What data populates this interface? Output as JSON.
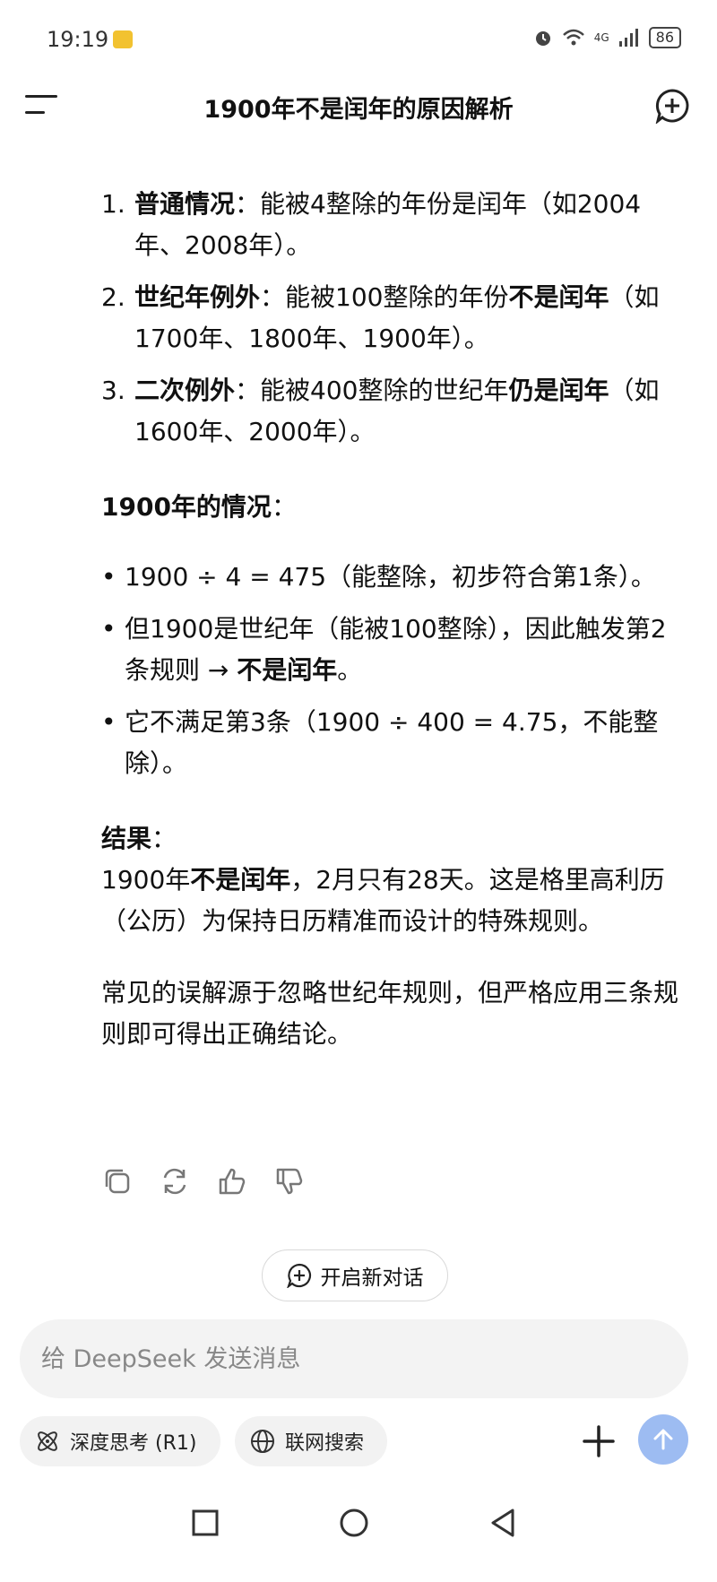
{
  "status": {
    "time": "19:19",
    "battery": "86",
    "network": "4G"
  },
  "header": {
    "title": "1900年不是闰年的原因解析"
  },
  "rules": [
    {
      "num": "1.",
      "bold": "普通情况",
      "text": "：能被4整除的年份是闰年（如2004年、2008年）。",
      "bold2": "",
      "text2": ""
    },
    {
      "num": "2.",
      "bold": "世纪年例外",
      "text": "：能被100整除的年份",
      "bold2": "不是闰年",
      "text2": "（如1700年、1800年、1900年）。"
    },
    {
      "num": "3.",
      "bold": "二次例外",
      "text": "：能被400整除的世纪年",
      "bold2": "仍是闰年",
      "text2": "（如1600年、2000年）。"
    }
  ],
  "case": {
    "heading_bold": "1900年的情况",
    "heading_tail": "：",
    "bullets": [
      {
        "text": "1900 ÷ 4 = 475（能整除，初步符合第1条）。",
        "bold": "",
        "tail": ""
      },
      {
        "text": "但1900是世纪年（能被100整除），因此触发第2条规则 → ",
        "bold": "不是闰年",
        "tail": "。"
      },
      {
        "text": "它不满足第3条（1900 ÷ 400 = 4.75，不能整除）。",
        "bold": "",
        "tail": ""
      }
    ]
  },
  "result": {
    "heading_bold": "结果",
    "heading_tail": "：",
    "pre": "1900年",
    "bold": "不是闰年",
    "post": "，2月只有28天。这是格里高利历（公历）为保持日历精准而设计的特殊规则。"
  },
  "closing": "常见的误解源于忽略世纪年规则，但严格应用三条规则即可得出正确结论。",
  "new_chat_label": "开启新对话",
  "input": {
    "placeholder": "给 DeepSeek 发送消息"
  },
  "chips": {
    "think": "深度思考 (R1)",
    "search": "联网搜索"
  },
  "colors": {
    "send_button": "#9dbcf2",
    "input_bg": "#f3f3f3"
  }
}
